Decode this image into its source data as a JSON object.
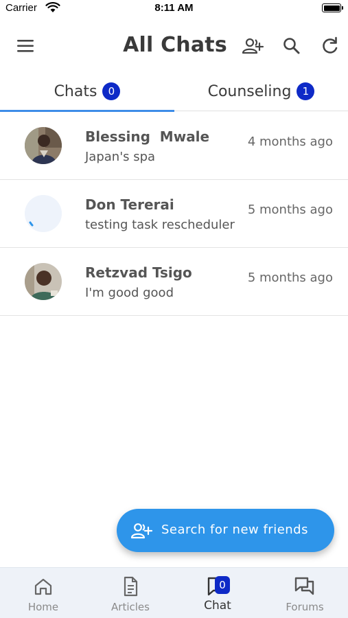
{
  "status_bar": {
    "carrier": "Carrier",
    "time": "8:11 AM"
  },
  "header": {
    "title": "All Chats"
  },
  "tabs": [
    {
      "label": "Chats",
      "badge": "0",
      "active": true
    },
    {
      "label": "Counseling",
      "badge": "1",
      "active": false
    }
  ],
  "chats": [
    {
      "name": "Blessing  Mwale",
      "preview": "Japan's spa",
      "time": "4 months ago",
      "avatar": "photo"
    },
    {
      "name": "Don Tererai",
      "preview": "testing task rescheduler",
      "time": "5 months ago",
      "avatar": "loading"
    },
    {
      "name": "Retzvad Tsigo",
      "preview": "I'm good good",
      "time": "5 months ago",
      "avatar": "photo"
    }
  ],
  "fab": {
    "label": "Search for new friends"
  },
  "bottom_nav": [
    {
      "label": "Home",
      "icon": "home-icon"
    },
    {
      "label": "Articles",
      "icon": "document-icon"
    },
    {
      "label": "Chat",
      "icon": "chat-icon",
      "badge": "0",
      "active": true
    },
    {
      "label": "Forums",
      "icon": "forums-icon"
    }
  ],
  "colors": {
    "accent": "#2e95ea",
    "badge": "#0e2ac7",
    "tab_indicator": "#3d8de8",
    "nav_bg": "#eef2f8"
  }
}
